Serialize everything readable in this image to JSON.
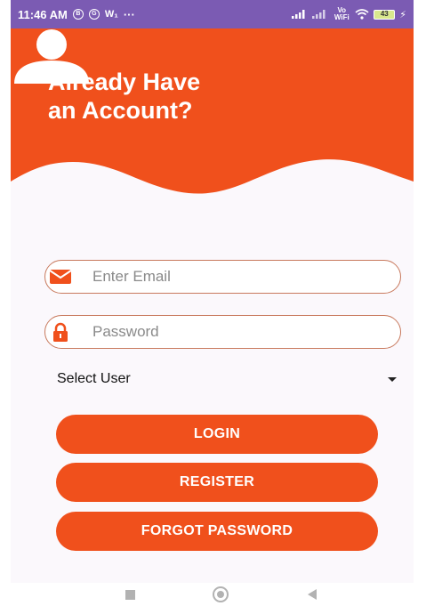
{
  "status_bar": {
    "time": "11:46 AM",
    "notif_icons": [
      "B",
      "G",
      "W₁",
      "···"
    ],
    "signal_text": "Vo WiFi",
    "battery": "43"
  },
  "header": {
    "title_line1": "Already Have",
    "title_line2": "an Account?",
    "background_color": "#f0501c"
  },
  "form": {
    "email_placeholder": "Enter Email",
    "password_placeholder": "Password",
    "select_user_label": "Select User"
  },
  "buttons": {
    "login": "LOGIN",
    "register": "REGISTER",
    "forgot_password": "FORGOT PASSWORD"
  },
  "colors": {
    "accent": "#f0501c",
    "status_bar": "#7b5bb3",
    "field_border": "#c8795d"
  }
}
